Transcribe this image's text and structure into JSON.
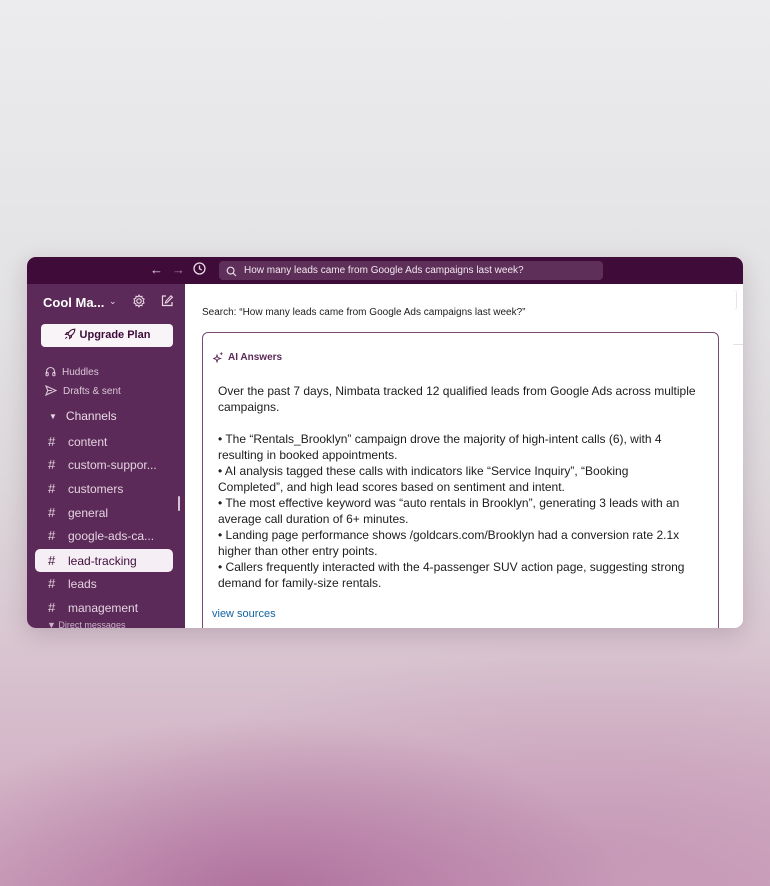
{
  "topbar": {
    "search_query": "How many leads came from Google Ads campaigns last week?",
    "back_icon": "arrow-left-icon",
    "forward_icon": "arrow-right-icon",
    "history_icon": "clock-icon"
  },
  "sidebar": {
    "workspace_name": "Cool Ma...",
    "upgrade_label": "Upgrade Plan",
    "huddles_label": "Huddles",
    "drafts_label": "Drafts & sent",
    "channels_header": "Channels",
    "channels": [
      {
        "name": "content"
      },
      {
        "name": "custom-suppor..."
      },
      {
        "name": "customers"
      },
      {
        "name": "general"
      },
      {
        "name": "google-ads-ca..."
      },
      {
        "name": "lead-tracking",
        "active": true
      },
      {
        "name": "leads"
      },
      {
        "name": "management"
      }
    ],
    "dm_header": "Direct messages"
  },
  "main": {
    "search_prefix": "Search:",
    "search_text": "“How many leads came from Google Ads campaigns last week?”",
    "ai": {
      "title": "AI Answers",
      "intro": "Over the past 7 days, Nimbata tracked 12 qualified leads from Google Ads across multiple campaigns.",
      "bullets": [
        "• The “Rentals_Brooklyn” campaign drove the majority of high-intent calls (6), with 4 resulting in booked appointments.",
        "• AI analysis tagged these calls with indicators like “Service Inquiry”, “Booking Completed”, and high lead scores based on sentiment and intent.",
        "• The most effective keyword was “auto rentals in Brooklyn”, generating 3 leads with an average call duration of 6+ minutes.",
        "• Landing page performance shows /goldcars.com/Brooklyn had a conversion rate 2.1x higher than other entry points.",
        "• Callers frequently interacted with the 4-passenger SUV action page, suggesting strong demand for family-size rentals."
      ],
      "view_sources": "view sources"
    }
  },
  "colors": {
    "titlebar": "#3f0c3a",
    "sidebar": "#5b2a58",
    "link": "#1264a3"
  }
}
